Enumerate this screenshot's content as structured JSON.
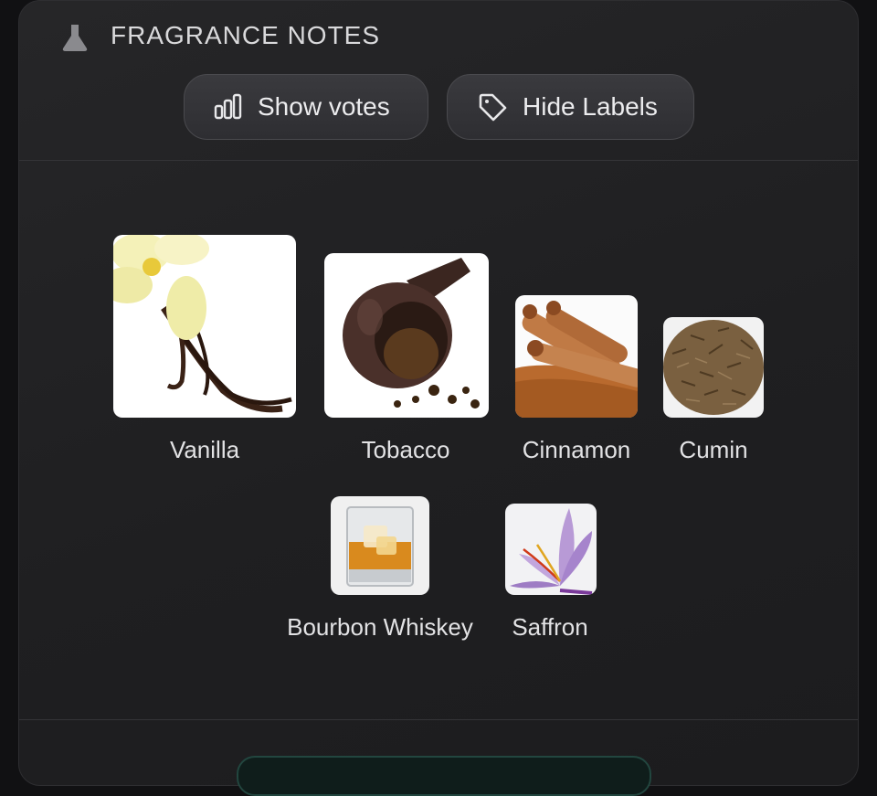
{
  "section": {
    "title": "FRAGRANCE NOTES",
    "icon": "flask-icon"
  },
  "buttons": {
    "show_votes": {
      "label": "Show votes",
      "icon": "bar-chart-icon"
    },
    "hide_labels": {
      "label": "Hide Labels",
      "icon": "tag-icon"
    }
  },
  "notes": [
    {
      "name": "Vanilla",
      "image": "vanilla-image"
    },
    {
      "name": "Tobacco",
      "image": "tobacco-image"
    },
    {
      "name": "Cinnamon",
      "image": "cinnamon-image"
    },
    {
      "name": "Cumin",
      "image": "cumin-image"
    },
    {
      "name": "Bourbon Whiskey",
      "image": "bourbon-whiskey-image"
    },
    {
      "name": "Saffron",
      "image": "saffron-image"
    }
  ],
  "colors": {
    "card_background": "#242426",
    "text": "#e2e2e4",
    "button_border": "#4a4a4e"
  }
}
